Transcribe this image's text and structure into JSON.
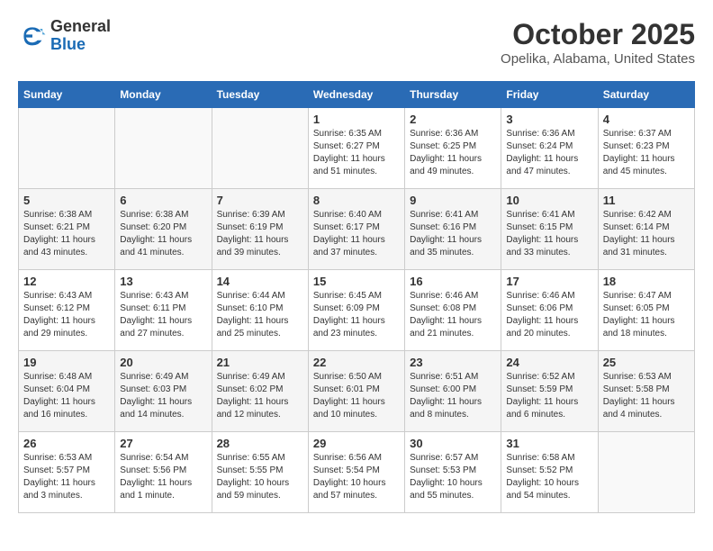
{
  "header": {
    "logo_general": "General",
    "logo_blue": "Blue",
    "month_title": "October 2025",
    "location": "Opelika, Alabama, United States"
  },
  "days_of_week": [
    "Sunday",
    "Monday",
    "Tuesday",
    "Wednesday",
    "Thursday",
    "Friday",
    "Saturday"
  ],
  "weeks": [
    [
      {
        "day": "",
        "info": ""
      },
      {
        "day": "",
        "info": ""
      },
      {
        "day": "",
        "info": ""
      },
      {
        "day": "1",
        "info": "Sunrise: 6:35 AM\nSunset: 6:27 PM\nDaylight: 11 hours\nand 51 minutes."
      },
      {
        "day": "2",
        "info": "Sunrise: 6:36 AM\nSunset: 6:25 PM\nDaylight: 11 hours\nand 49 minutes."
      },
      {
        "day": "3",
        "info": "Sunrise: 6:36 AM\nSunset: 6:24 PM\nDaylight: 11 hours\nand 47 minutes."
      },
      {
        "day": "4",
        "info": "Sunrise: 6:37 AM\nSunset: 6:23 PM\nDaylight: 11 hours\nand 45 minutes."
      }
    ],
    [
      {
        "day": "5",
        "info": "Sunrise: 6:38 AM\nSunset: 6:21 PM\nDaylight: 11 hours\nand 43 minutes."
      },
      {
        "day": "6",
        "info": "Sunrise: 6:38 AM\nSunset: 6:20 PM\nDaylight: 11 hours\nand 41 minutes."
      },
      {
        "day": "7",
        "info": "Sunrise: 6:39 AM\nSunset: 6:19 PM\nDaylight: 11 hours\nand 39 minutes."
      },
      {
        "day": "8",
        "info": "Sunrise: 6:40 AM\nSunset: 6:17 PM\nDaylight: 11 hours\nand 37 minutes."
      },
      {
        "day": "9",
        "info": "Sunrise: 6:41 AM\nSunset: 6:16 PM\nDaylight: 11 hours\nand 35 minutes."
      },
      {
        "day": "10",
        "info": "Sunrise: 6:41 AM\nSunset: 6:15 PM\nDaylight: 11 hours\nand 33 minutes."
      },
      {
        "day": "11",
        "info": "Sunrise: 6:42 AM\nSunset: 6:14 PM\nDaylight: 11 hours\nand 31 minutes."
      }
    ],
    [
      {
        "day": "12",
        "info": "Sunrise: 6:43 AM\nSunset: 6:12 PM\nDaylight: 11 hours\nand 29 minutes."
      },
      {
        "day": "13",
        "info": "Sunrise: 6:43 AM\nSunset: 6:11 PM\nDaylight: 11 hours\nand 27 minutes."
      },
      {
        "day": "14",
        "info": "Sunrise: 6:44 AM\nSunset: 6:10 PM\nDaylight: 11 hours\nand 25 minutes."
      },
      {
        "day": "15",
        "info": "Sunrise: 6:45 AM\nSunset: 6:09 PM\nDaylight: 11 hours\nand 23 minutes."
      },
      {
        "day": "16",
        "info": "Sunrise: 6:46 AM\nSunset: 6:08 PM\nDaylight: 11 hours\nand 21 minutes."
      },
      {
        "day": "17",
        "info": "Sunrise: 6:46 AM\nSunset: 6:06 PM\nDaylight: 11 hours\nand 20 minutes."
      },
      {
        "day": "18",
        "info": "Sunrise: 6:47 AM\nSunset: 6:05 PM\nDaylight: 11 hours\nand 18 minutes."
      }
    ],
    [
      {
        "day": "19",
        "info": "Sunrise: 6:48 AM\nSunset: 6:04 PM\nDaylight: 11 hours\nand 16 minutes."
      },
      {
        "day": "20",
        "info": "Sunrise: 6:49 AM\nSunset: 6:03 PM\nDaylight: 11 hours\nand 14 minutes."
      },
      {
        "day": "21",
        "info": "Sunrise: 6:49 AM\nSunset: 6:02 PM\nDaylight: 11 hours\nand 12 minutes."
      },
      {
        "day": "22",
        "info": "Sunrise: 6:50 AM\nSunset: 6:01 PM\nDaylight: 11 hours\nand 10 minutes."
      },
      {
        "day": "23",
        "info": "Sunrise: 6:51 AM\nSunset: 6:00 PM\nDaylight: 11 hours\nand 8 minutes."
      },
      {
        "day": "24",
        "info": "Sunrise: 6:52 AM\nSunset: 5:59 PM\nDaylight: 11 hours\nand 6 minutes."
      },
      {
        "day": "25",
        "info": "Sunrise: 6:53 AM\nSunset: 5:58 PM\nDaylight: 11 hours\nand 4 minutes."
      }
    ],
    [
      {
        "day": "26",
        "info": "Sunrise: 6:53 AM\nSunset: 5:57 PM\nDaylight: 11 hours\nand 3 minutes."
      },
      {
        "day": "27",
        "info": "Sunrise: 6:54 AM\nSunset: 5:56 PM\nDaylight: 11 hours\nand 1 minute."
      },
      {
        "day": "28",
        "info": "Sunrise: 6:55 AM\nSunset: 5:55 PM\nDaylight: 10 hours\nand 59 minutes."
      },
      {
        "day": "29",
        "info": "Sunrise: 6:56 AM\nSunset: 5:54 PM\nDaylight: 10 hours\nand 57 minutes."
      },
      {
        "day": "30",
        "info": "Sunrise: 6:57 AM\nSunset: 5:53 PM\nDaylight: 10 hours\nand 55 minutes."
      },
      {
        "day": "31",
        "info": "Sunrise: 6:58 AM\nSunset: 5:52 PM\nDaylight: 10 hours\nand 54 minutes."
      },
      {
        "day": "",
        "info": ""
      }
    ]
  ]
}
